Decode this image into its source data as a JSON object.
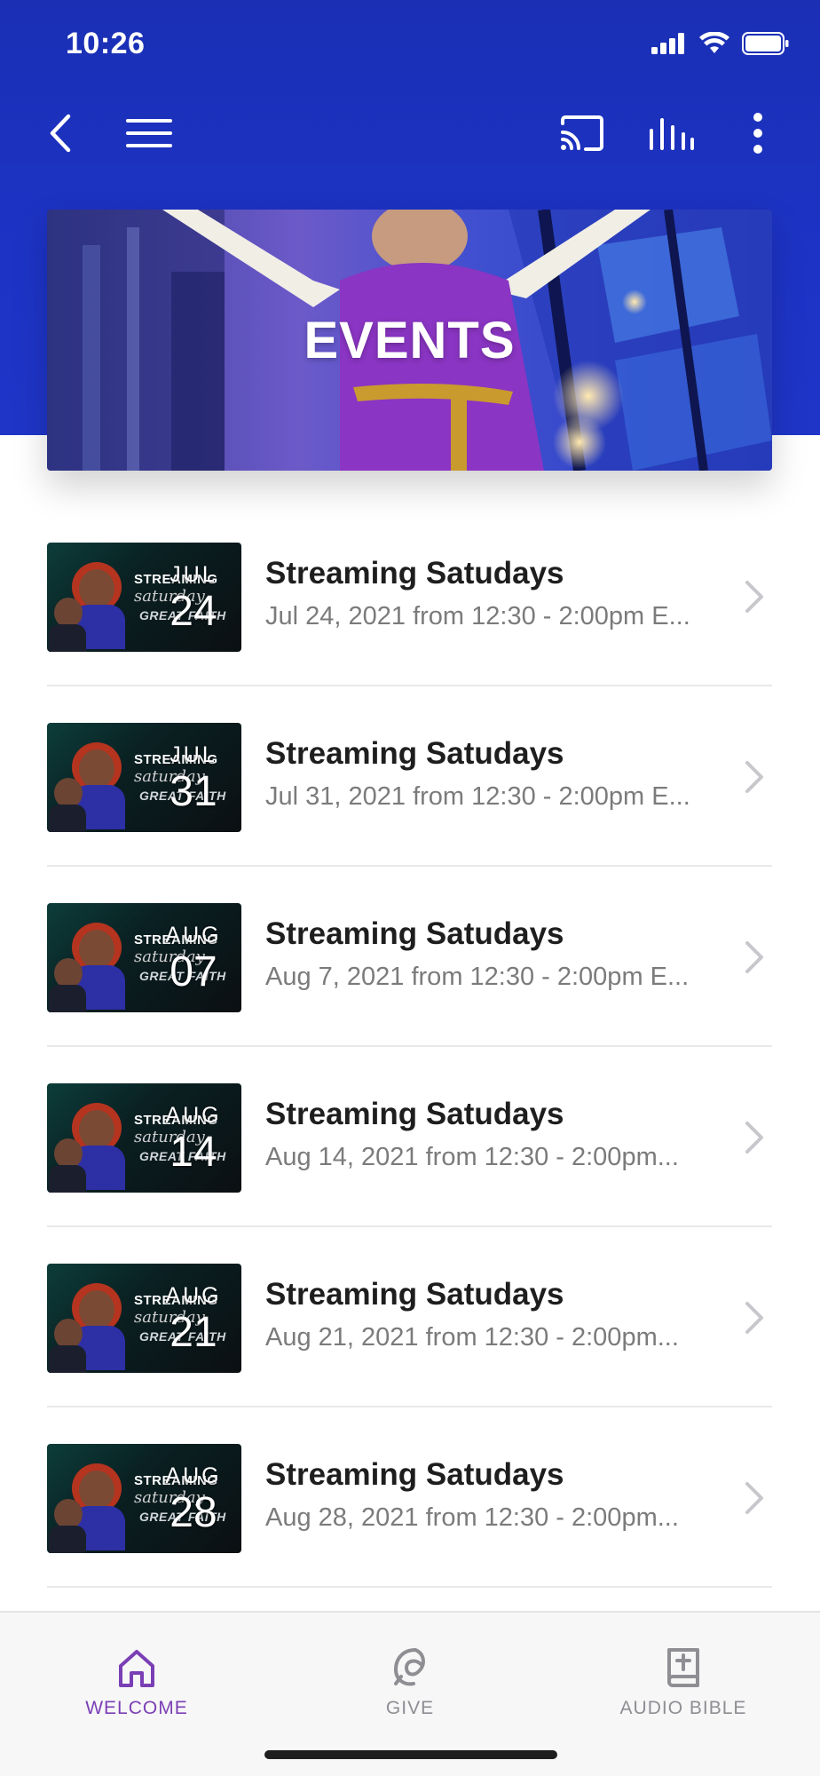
{
  "status_bar": {
    "time": "10:26"
  },
  "nav": {
    "back_icon": "chevron-left-icon",
    "menu_icon": "hamburger-menu-icon",
    "cast_icon": "cast-icon",
    "equalizer_icon": "equalizer-icon",
    "more_icon": "more-vertical-icon"
  },
  "banner": {
    "title": "EVENTS"
  },
  "events": [
    {
      "title": "Streaming Satudays",
      "subtitle": "Jul 24, 2021 from 12:30 - 2:00pm E...",
      "month": "JUL",
      "day": "24"
    },
    {
      "title": "Streaming Satudays",
      "subtitle": "Jul 31, 2021 from 12:30 - 2:00pm E...",
      "month": "JUL",
      "day": "31"
    },
    {
      "title": "Streaming Satudays",
      "subtitle": "Aug 7, 2021 from 12:30 - 2:00pm E...",
      "month": "AUG",
      "day": "07"
    },
    {
      "title": "Streaming Satudays",
      "subtitle": "Aug 14, 2021 from 12:30 - 2:00pm...",
      "month": "AUG",
      "day": "14"
    },
    {
      "title": "Streaming Satudays",
      "subtitle": "Aug 21, 2021 from 12:30 - 2:00pm...",
      "month": "AUG",
      "day": "21"
    },
    {
      "title": "Streaming Satudays",
      "subtitle": "Aug 28, 2021 from 12:30 - 2:00pm...",
      "month": "AUG",
      "day": "28"
    }
  ],
  "thumbnail": {
    "line1": "STREAMING",
    "line2": "saturday",
    "line3": "GREAT FAITH"
  },
  "tabs": [
    {
      "label": "WELCOME",
      "icon": "home-icon",
      "active": true
    },
    {
      "label": "GIVE",
      "icon": "give-icon",
      "active": false
    },
    {
      "label": "AUDIO BIBLE",
      "icon": "bible-icon",
      "active": false
    }
  ],
  "colors": {
    "header_blue": "#1d33c6",
    "active_tab": "#7b3fb5",
    "inactive_tab": "#8e8e93"
  }
}
